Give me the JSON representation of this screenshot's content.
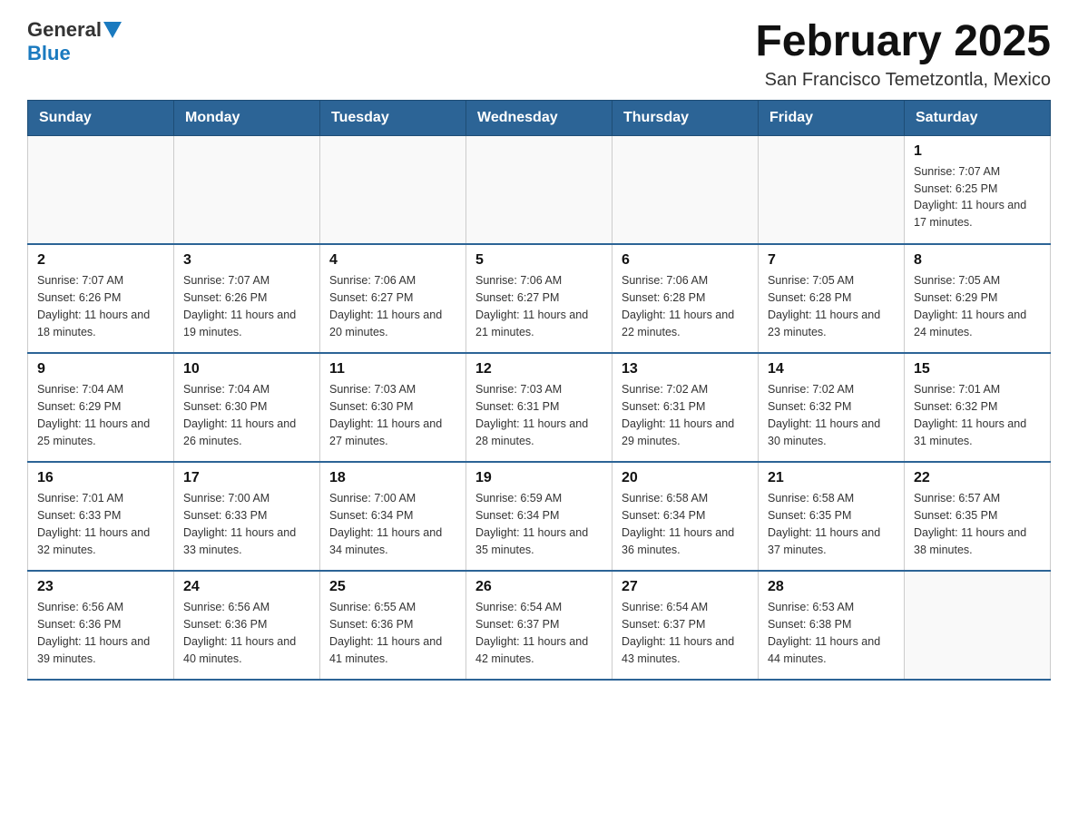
{
  "header": {
    "logo_general": "General",
    "logo_blue": "Blue",
    "title": "February 2025",
    "subtitle": "San Francisco Temetzontla, Mexico"
  },
  "days_of_week": [
    "Sunday",
    "Monday",
    "Tuesday",
    "Wednesday",
    "Thursday",
    "Friday",
    "Saturday"
  ],
  "weeks": [
    [
      {
        "day": "",
        "info": ""
      },
      {
        "day": "",
        "info": ""
      },
      {
        "day": "",
        "info": ""
      },
      {
        "day": "",
        "info": ""
      },
      {
        "day": "",
        "info": ""
      },
      {
        "day": "",
        "info": ""
      },
      {
        "day": "1",
        "info": "Sunrise: 7:07 AM\nSunset: 6:25 PM\nDaylight: 11 hours and 17 minutes."
      }
    ],
    [
      {
        "day": "2",
        "info": "Sunrise: 7:07 AM\nSunset: 6:26 PM\nDaylight: 11 hours and 18 minutes."
      },
      {
        "day": "3",
        "info": "Sunrise: 7:07 AM\nSunset: 6:26 PM\nDaylight: 11 hours and 19 minutes."
      },
      {
        "day": "4",
        "info": "Sunrise: 7:06 AM\nSunset: 6:27 PM\nDaylight: 11 hours and 20 minutes."
      },
      {
        "day": "5",
        "info": "Sunrise: 7:06 AM\nSunset: 6:27 PM\nDaylight: 11 hours and 21 minutes."
      },
      {
        "day": "6",
        "info": "Sunrise: 7:06 AM\nSunset: 6:28 PM\nDaylight: 11 hours and 22 minutes."
      },
      {
        "day": "7",
        "info": "Sunrise: 7:05 AM\nSunset: 6:28 PM\nDaylight: 11 hours and 23 minutes."
      },
      {
        "day": "8",
        "info": "Sunrise: 7:05 AM\nSunset: 6:29 PM\nDaylight: 11 hours and 24 minutes."
      }
    ],
    [
      {
        "day": "9",
        "info": "Sunrise: 7:04 AM\nSunset: 6:29 PM\nDaylight: 11 hours and 25 minutes."
      },
      {
        "day": "10",
        "info": "Sunrise: 7:04 AM\nSunset: 6:30 PM\nDaylight: 11 hours and 26 minutes."
      },
      {
        "day": "11",
        "info": "Sunrise: 7:03 AM\nSunset: 6:30 PM\nDaylight: 11 hours and 27 minutes."
      },
      {
        "day": "12",
        "info": "Sunrise: 7:03 AM\nSunset: 6:31 PM\nDaylight: 11 hours and 28 minutes."
      },
      {
        "day": "13",
        "info": "Sunrise: 7:02 AM\nSunset: 6:31 PM\nDaylight: 11 hours and 29 minutes."
      },
      {
        "day": "14",
        "info": "Sunrise: 7:02 AM\nSunset: 6:32 PM\nDaylight: 11 hours and 30 minutes."
      },
      {
        "day": "15",
        "info": "Sunrise: 7:01 AM\nSunset: 6:32 PM\nDaylight: 11 hours and 31 minutes."
      }
    ],
    [
      {
        "day": "16",
        "info": "Sunrise: 7:01 AM\nSunset: 6:33 PM\nDaylight: 11 hours and 32 minutes."
      },
      {
        "day": "17",
        "info": "Sunrise: 7:00 AM\nSunset: 6:33 PM\nDaylight: 11 hours and 33 minutes."
      },
      {
        "day": "18",
        "info": "Sunrise: 7:00 AM\nSunset: 6:34 PM\nDaylight: 11 hours and 34 minutes."
      },
      {
        "day": "19",
        "info": "Sunrise: 6:59 AM\nSunset: 6:34 PM\nDaylight: 11 hours and 35 minutes."
      },
      {
        "day": "20",
        "info": "Sunrise: 6:58 AM\nSunset: 6:34 PM\nDaylight: 11 hours and 36 minutes."
      },
      {
        "day": "21",
        "info": "Sunrise: 6:58 AM\nSunset: 6:35 PM\nDaylight: 11 hours and 37 minutes."
      },
      {
        "day": "22",
        "info": "Sunrise: 6:57 AM\nSunset: 6:35 PM\nDaylight: 11 hours and 38 minutes."
      }
    ],
    [
      {
        "day": "23",
        "info": "Sunrise: 6:56 AM\nSunset: 6:36 PM\nDaylight: 11 hours and 39 minutes."
      },
      {
        "day": "24",
        "info": "Sunrise: 6:56 AM\nSunset: 6:36 PM\nDaylight: 11 hours and 40 minutes."
      },
      {
        "day": "25",
        "info": "Sunrise: 6:55 AM\nSunset: 6:36 PM\nDaylight: 11 hours and 41 minutes."
      },
      {
        "day": "26",
        "info": "Sunrise: 6:54 AM\nSunset: 6:37 PM\nDaylight: 11 hours and 42 minutes."
      },
      {
        "day": "27",
        "info": "Sunrise: 6:54 AM\nSunset: 6:37 PM\nDaylight: 11 hours and 43 minutes."
      },
      {
        "day": "28",
        "info": "Sunrise: 6:53 AM\nSunset: 6:38 PM\nDaylight: 11 hours and 44 minutes."
      },
      {
        "day": "",
        "info": ""
      }
    ]
  ]
}
